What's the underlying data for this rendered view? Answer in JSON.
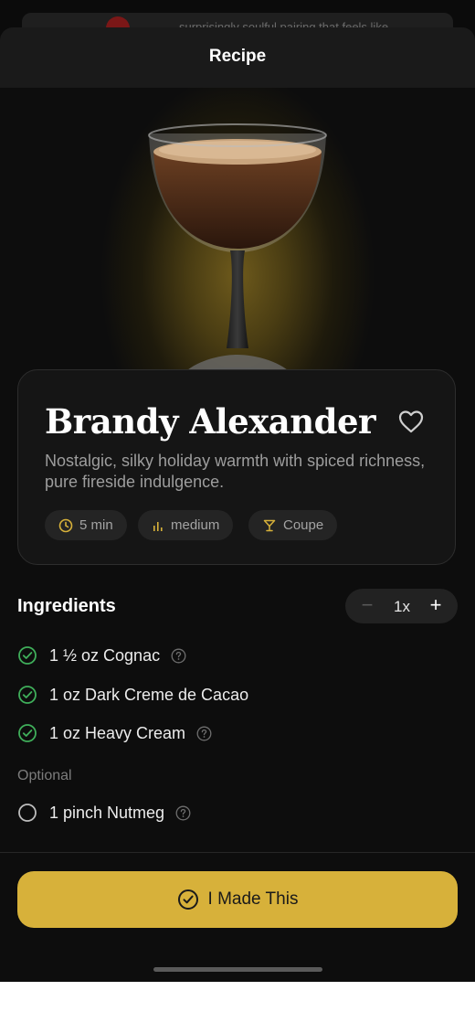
{
  "behind": {
    "text": "surprisingly soulful pairing that feels like"
  },
  "header": {
    "title": "Recipe"
  },
  "drink": {
    "name": "Brandy Alexander",
    "description": "Nostalgic, silky holiday warmth with spiced richness, pure fireside indulgence.",
    "meta": [
      {
        "icon": "clock-icon",
        "label": "5 min"
      },
      {
        "icon": "difficulty-bars-icon",
        "label": "medium"
      },
      {
        "icon": "cocktail-glass-icon",
        "label": "Coupe"
      }
    ]
  },
  "ingredients": {
    "title": "Ingredients",
    "stepper": {
      "minus": "−",
      "value": "1x",
      "plus": "+"
    },
    "required": [
      {
        "text": "1 ½ oz Cognac",
        "checked": true,
        "help": true
      },
      {
        "text": "1 oz Dark Creme de Cacao",
        "checked": true,
        "help": false
      },
      {
        "text": "1 oz Heavy Cream",
        "checked": true,
        "help": true
      }
    ],
    "optional_label": "Optional",
    "optional": [
      {
        "text": "1 pinch Nutmeg",
        "checked": false,
        "help": true
      }
    ]
  },
  "action": {
    "made_label": "I Made This"
  },
  "colors": {
    "accent": "#d7b13a",
    "check": "#3fae5a",
    "background": "#0d0d0d"
  }
}
